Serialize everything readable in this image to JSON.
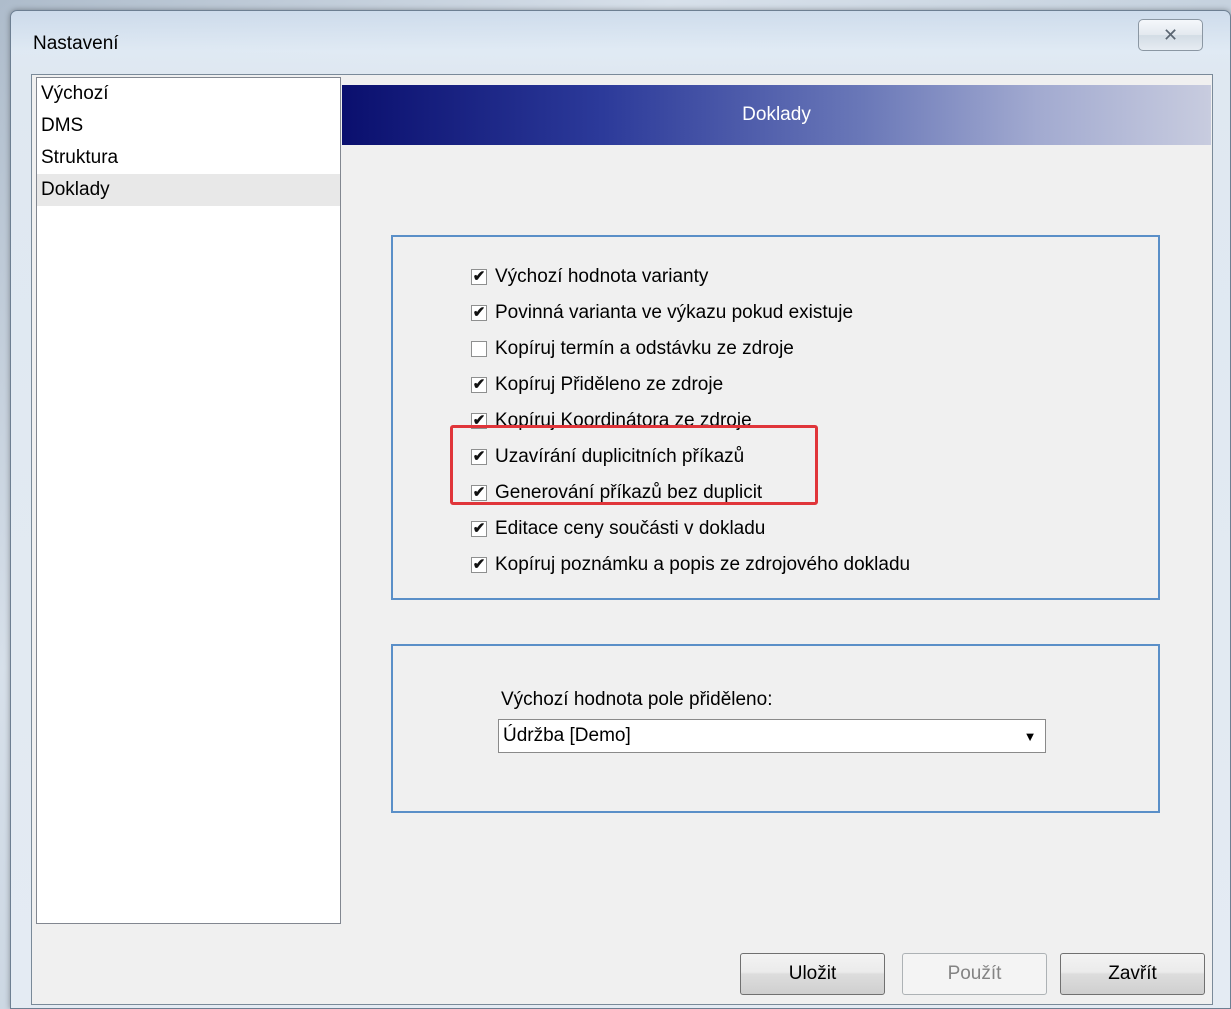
{
  "window": {
    "title": "Nastavení",
    "close_glyph": "✕"
  },
  "sidebar": {
    "items": [
      {
        "label": "Výchozí",
        "selected": false
      },
      {
        "label": "DMS",
        "selected": false
      },
      {
        "label": "Struktura",
        "selected": false
      },
      {
        "label": "Doklady",
        "selected": true
      }
    ]
  },
  "header": {
    "title": "Doklady"
  },
  "options": [
    {
      "label": "Výchozí hodnota varianty",
      "checked": true
    },
    {
      "label": "Povinná varianta ve výkazu pokud existuje",
      "checked": true
    },
    {
      "label": "Kopíruj termín a odstávku ze zdroje",
      "checked": false
    },
    {
      "label": "Kopíruj Přiděleno ze zdroje",
      "checked": true
    },
    {
      "label": "Kopíruj Koordinátora ze zdroje",
      "checked": true
    },
    {
      "label": "Uzavírání duplicitních příkazů",
      "checked": true
    },
    {
      "label": "Generování příkazů bez duplicit",
      "checked": true
    },
    {
      "label": "Editace ceny součásti v dokladu",
      "checked": true
    },
    {
      "label": "Kopíruj poznámku a popis ze zdrojového dokladu",
      "checked": true
    }
  ],
  "assigned": {
    "label": "Výchozí hodnota pole přiděleno:",
    "value": "Údržba [Demo]",
    "arrow_glyph": "▼"
  },
  "buttons": {
    "save": "Uložit",
    "apply": "Použít",
    "close": "Zavřít"
  },
  "check_glyph": "✔",
  "colors": {
    "highlight": "#e0353a",
    "groupbox_border": "#5a8fc8",
    "header_start": "#0a0f6e"
  }
}
